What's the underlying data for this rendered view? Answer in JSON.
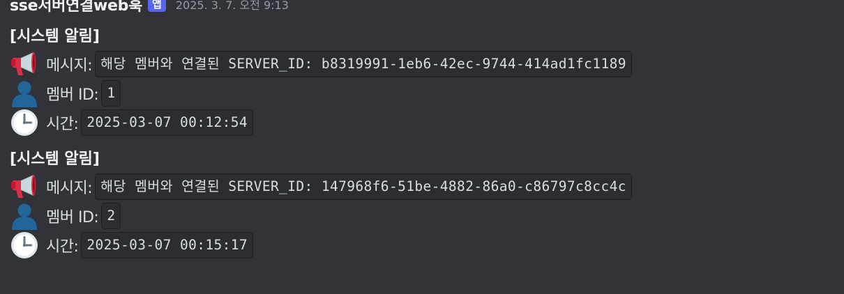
{
  "header": {
    "username": "sse서버연결web훅",
    "badge": "앱",
    "timestamp": "2025. 3. 7. 오전 9:13"
  },
  "alerts": [
    {
      "title": "[시스템 알림]",
      "message_label": "메시지:",
      "message_value": "해당 멤버와 연결된 SERVER_ID: b8319991-1eb6-42ec-9744-414ad1fc1189",
      "member_label": "멤버 ID:",
      "member_value": "1",
      "time_label": "시간:",
      "time_value": "2025-03-07 00:12:54"
    },
    {
      "title": "[시스템 알림]",
      "message_label": "메시지:",
      "message_value": "해당 멤버와 연결된 SERVER_ID: 147968f6-51be-4882-86a0-c86797c8cc4c",
      "member_label": "멤버 ID:",
      "member_value": "2",
      "time_label": "시간:",
      "time_value": "2025-03-07 00:15:17"
    }
  ],
  "icons": {
    "message": "loudspeaker-icon",
    "member": "bust-in-silhouette-icon",
    "time": "three-oclock-icon"
  },
  "colors": {
    "background": "#323339",
    "badge": "#5865f2",
    "code_background": "#2b2d31",
    "timestamp": "#949ba4"
  }
}
